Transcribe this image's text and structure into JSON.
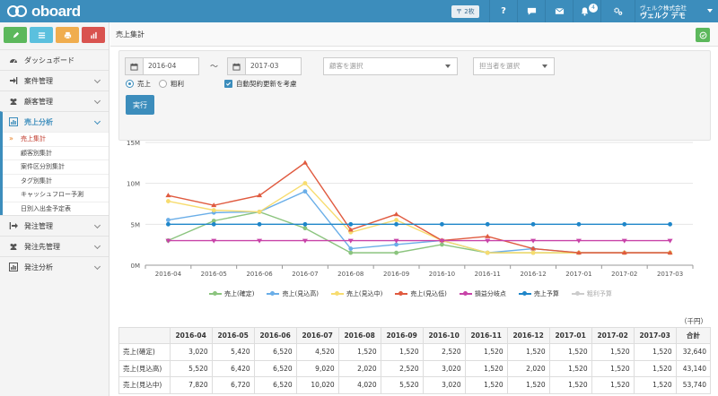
{
  "app": {
    "logo_text": "oboard",
    "plan_label": "〒 2枚",
    "notification_count": "4",
    "user_company": "ヴェルク株式会社",
    "user_name": "ヴェルク デモ",
    "accent": "#3c8dbc"
  },
  "topbar_buttons": [
    {
      "name": "help-icon",
      "glyph": "?"
    },
    {
      "name": "chat-icon"
    },
    {
      "name": "mail-icon"
    },
    {
      "name": "bell-icon"
    },
    {
      "name": "gear-icon"
    }
  ],
  "sidebar": {
    "tools": [
      {
        "name": "edit-icon",
        "color": "#5cb85c"
      },
      {
        "name": "list-icon",
        "color": "#5bc0de"
      },
      {
        "name": "print-icon",
        "color": "#f0ad4e"
      },
      {
        "name": "chart-icon",
        "color": "#d9534f"
      }
    ],
    "items": [
      {
        "label": "ダッシュボード",
        "icon": "dashboard-icon"
      },
      {
        "label": "案件管理",
        "icon": "signin-icon"
      },
      {
        "label": "顧客管理",
        "icon": "users-icon"
      },
      {
        "label": "売上分析",
        "icon": "bar-chart-icon",
        "active": true
      },
      {
        "label": "発注管理",
        "icon": "signout-icon"
      },
      {
        "label": "発注先管理",
        "icon": "users-icon"
      },
      {
        "label": "発注分析",
        "icon": "bar-chart-icon"
      }
    ],
    "sub_items": [
      {
        "label": "売上集計",
        "current": true
      },
      {
        "label": "顧客別集計"
      },
      {
        "label": "案件区分別集計"
      },
      {
        "label": "タグ別集計"
      },
      {
        "label": "キャッシュフロー予測"
      },
      {
        "label": "日別入出金予定表"
      }
    ]
  },
  "page": {
    "title": "売上集計"
  },
  "filter": {
    "date_from": "2016-04",
    "date_to": "2017-03",
    "tilde": "〜",
    "customer_placeholder": "顧客を選択",
    "assignee_placeholder": "担当者を選択",
    "radio_sales": "売上",
    "radio_gross": "粗利",
    "auto_renew_label": "自動契約更新を考慮",
    "run_label": "実行"
  },
  "chart_data": {
    "type": "line",
    "categories": [
      "2016-04",
      "2016-05",
      "2016-06",
      "2016-07",
      "2016-08",
      "2016-09",
      "2016-10",
      "2016-11",
      "2016-12",
      "2017-01",
      "2017-02",
      "2017-03"
    ],
    "ylim": [
      0,
      15000000
    ],
    "yticks": [
      {
        "v": 0,
        "label": "0M"
      },
      {
        "v": 5000000,
        "label": "5M"
      },
      {
        "v": 10000000,
        "label": "10M"
      },
      {
        "v": 15000000,
        "label": "15M"
      }
    ],
    "grid": "horizontal",
    "legend_position": "bottom",
    "series": [
      {
        "name": "売上(確定)",
        "color": "#8bc47e",
        "marker": "circle",
        "values": [
          3020000,
          5420000,
          6520000,
          4520000,
          1520000,
          1520000,
          2520000,
          1520000,
          1520000,
          1520000,
          1520000,
          1520000
        ]
      },
      {
        "name": "売上(見込高)",
        "color": "#6aaee8",
        "marker": "circle",
        "values": [
          5520000,
          6420000,
          6520000,
          9020000,
          2020000,
          2520000,
          3020000,
          1520000,
          2020000,
          1520000,
          1520000,
          1520000
        ]
      },
      {
        "name": "売上(見込中)",
        "color": "#f7dc6f",
        "marker": "circle",
        "values": [
          7820000,
          6720000,
          6520000,
          10020000,
          4020000,
          5520000,
          3020000,
          1520000,
          1520000,
          1520000,
          1520000,
          1520000
        ]
      },
      {
        "name": "売上(見込低)",
        "color": "#e05a3f",
        "marker": "triangle",
        "values": [
          8520000,
          7320000,
          8520000,
          12520000,
          4320000,
          6220000,
          3020000,
          3520000,
          2020000,
          1520000,
          1520000,
          1520000
        ]
      },
      {
        "name": "損益分岐点",
        "color": "#c843a8",
        "marker": "triangle-down",
        "values": [
          3000000,
          3000000,
          3000000,
          3000000,
          3000000,
          3000000,
          3000000,
          3000000,
          3000000,
          3000000,
          3000000,
          3000000
        ]
      },
      {
        "name": "売上予算",
        "color": "#1f86c9",
        "marker": "circle",
        "values": [
          5000000,
          5000000,
          5000000,
          5000000,
          5000000,
          5000000,
          5000000,
          5000000,
          5000000,
          5000000,
          5000000,
          5000000
        ]
      },
      {
        "name": "粗利予算",
        "color": "#cccccc",
        "marker": "circle",
        "muted": true,
        "values": []
      }
    ]
  },
  "table": {
    "unit": "（千円）",
    "headers": [
      "",
      "2016-04",
      "2016-05",
      "2016-06",
      "2016-07",
      "2016-08",
      "2016-09",
      "2016-10",
      "2016-11",
      "2016-12",
      "2017-01",
      "2017-02",
      "2017-03",
      "合計"
    ],
    "rows": [
      [
        "売上(確定)",
        "3,020",
        "5,420",
        "6,520",
        "4,520",
        "1,520",
        "1,520",
        "2,520",
        "1,520",
        "1,520",
        "1,520",
        "1,520",
        "1,520",
        "32,640"
      ],
      [
        "売上(見込高)",
        "5,520",
        "6,420",
        "6,520",
        "9,020",
        "2,020",
        "2,520",
        "3,020",
        "1,520",
        "2,020",
        "1,520",
        "1,520",
        "1,520",
        "43,140"
      ],
      [
        "売上(見込中)",
        "7,820",
        "6,720",
        "6,520",
        "10,020",
        "4,020",
        "5,520",
        "3,020",
        "1,520",
        "1,520",
        "1,520",
        "1,520",
        "1,520",
        "53,740"
      ]
    ]
  }
}
